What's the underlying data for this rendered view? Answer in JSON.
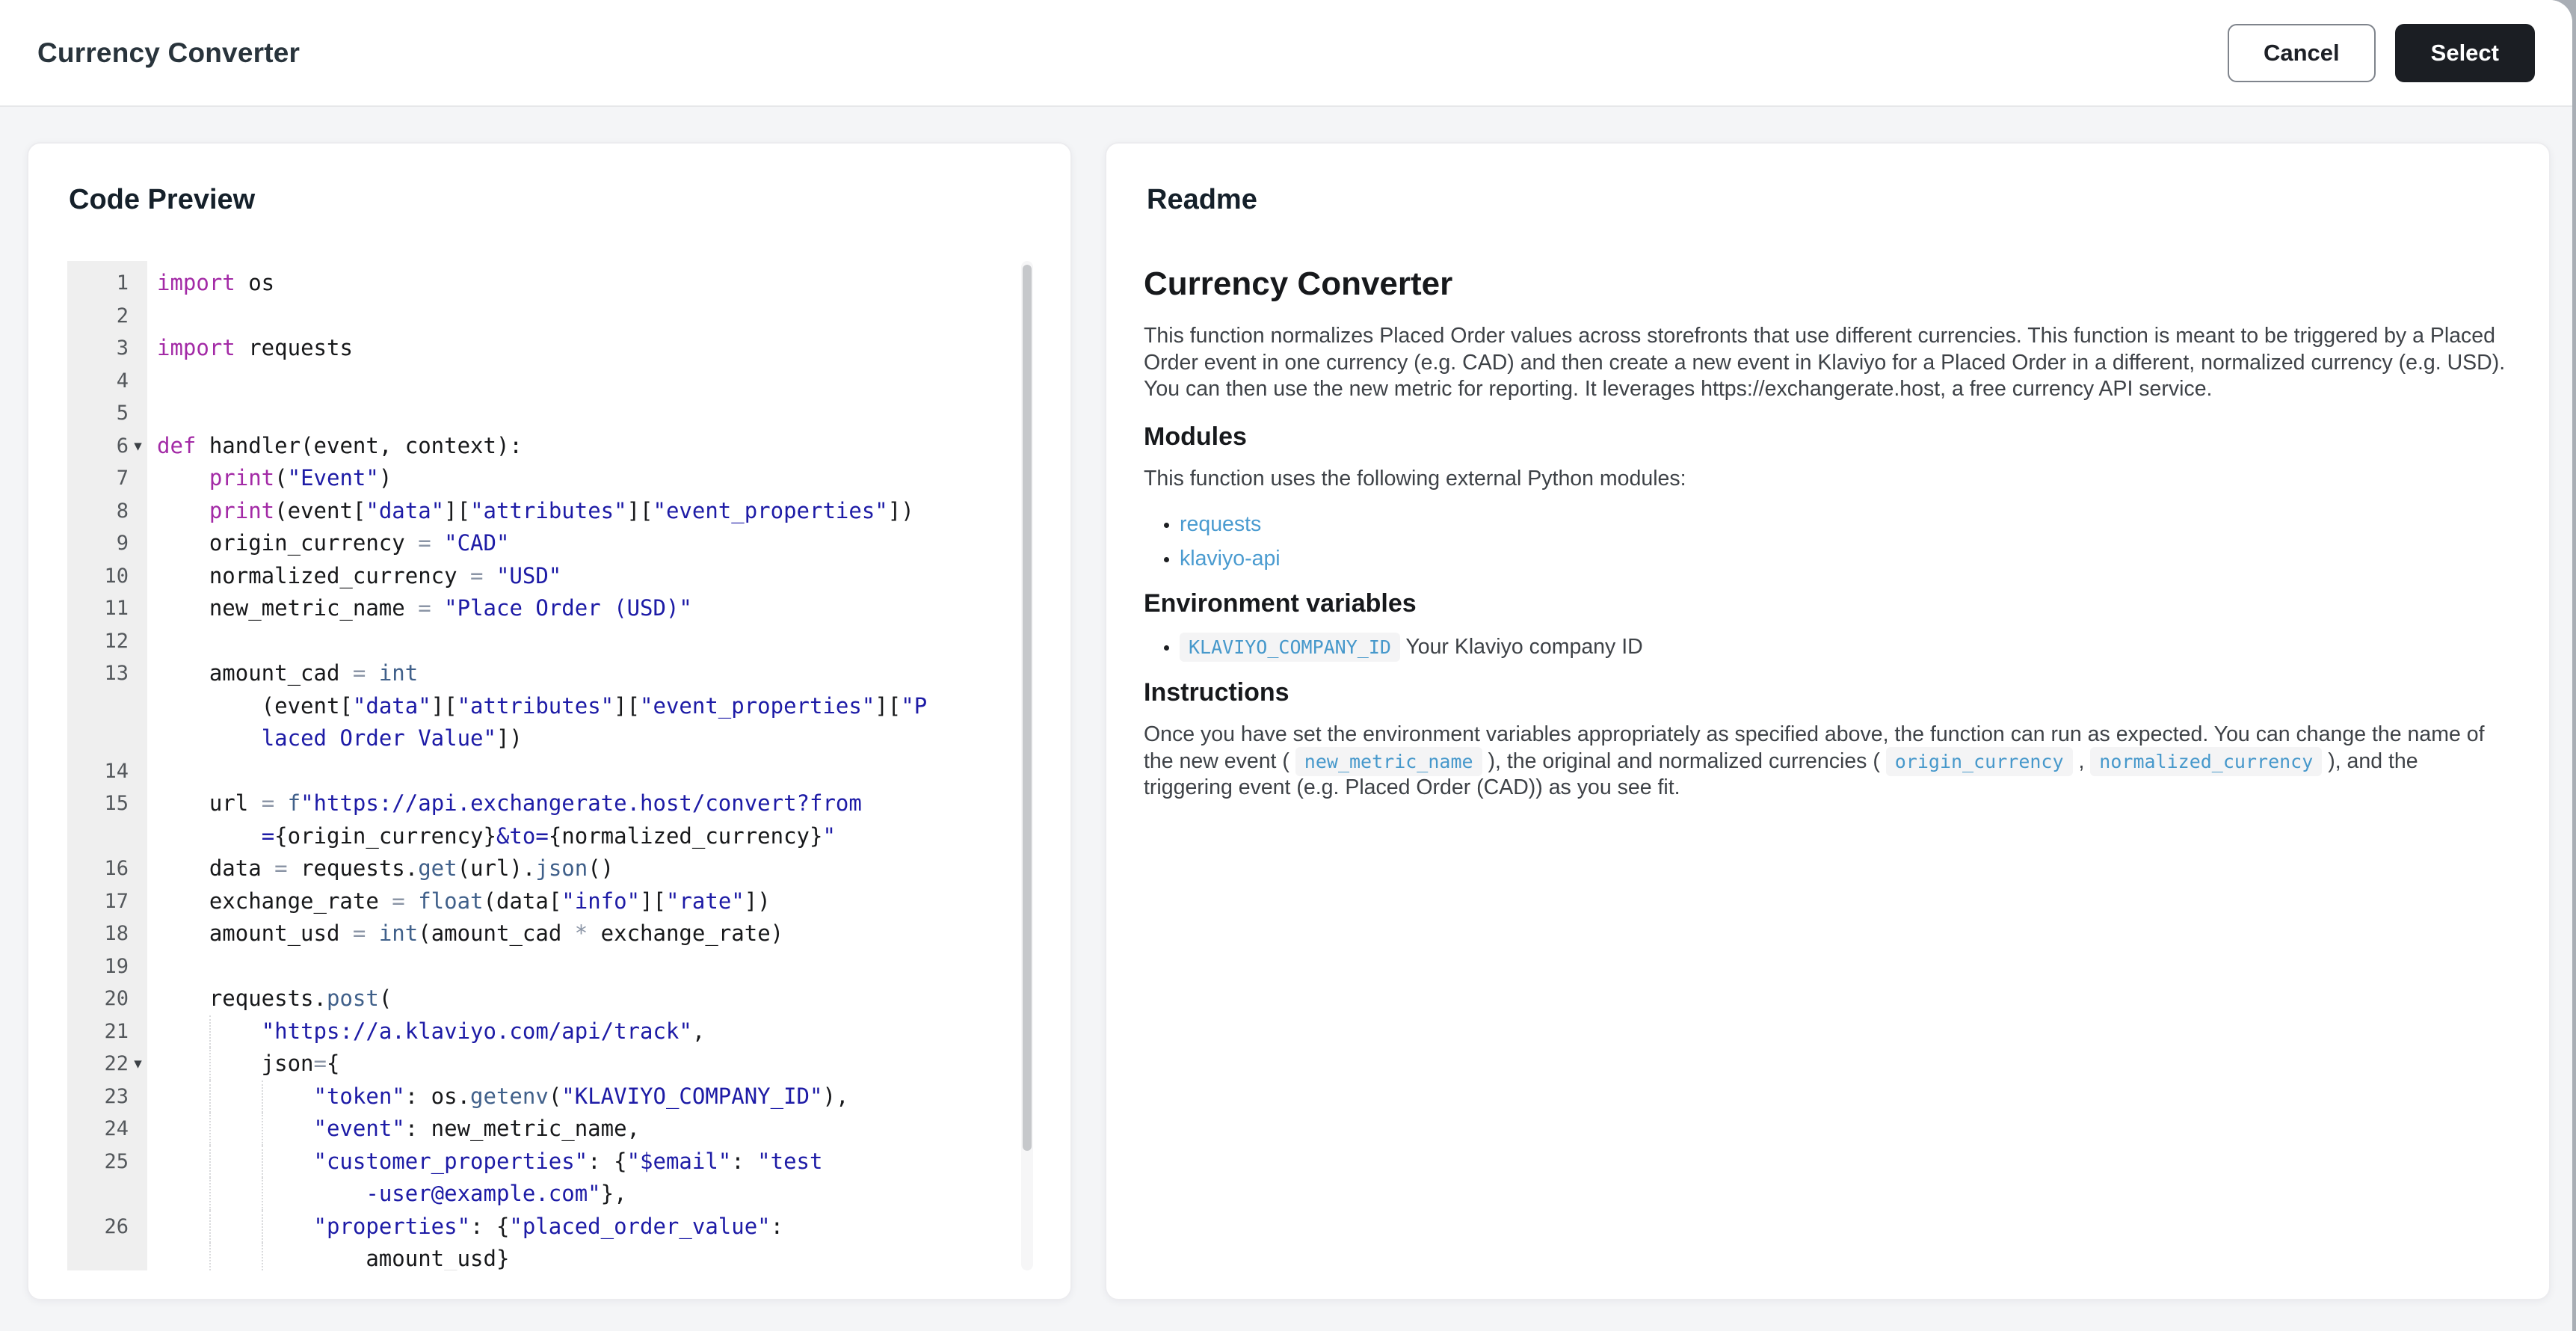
{
  "header": {
    "title": "Currency Converter",
    "cancel_label": "Cancel",
    "select_label": "Select"
  },
  "colors": {
    "accent_dark_button": "#1b1e23",
    "link_blue": "#4a9bd0",
    "inline_code_blue": "#4698cb",
    "token_keyword": "#a32aa6",
    "token_string": "#1d1ba6",
    "token_builtin": "#40608a",
    "token_operator": "#8b95a6",
    "gutter_bg": "#efefef",
    "page_bg": "#f4f5f7"
  },
  "code_panel": {
    "title": "Code Preview",
    "rows": [
      {
        "n": "1",
        "parts": [
          [
            "kw",
            "import"
          ],
          [
            "pl",
            " os"
          ]
        ]
      },
      {
        "n": "2",
        "parts": []
      },
      {
        "n": "3",
        "parts": [
          [
            "kw",
            "import"
          ],
          [
            "pl",
            " requests"
          ]
        ]
      },
      {
        "n": "4",
        "parts": []
      },
      {
        "n": "5",
        "parts": []
      },
      {
        "n": "6",
        "fold": true,
        "parts": [
          [
            "kw",
            "def"
          ],
          [
            "pl",
            " handler(event, context):"
          ]
        ]
      },
      {
        "n": "7",
        "parts": [
          [
            "pl",
            "    "
          ],
          [
            "kw",
            "print"
          ],
          [
            "pl",
            "("
          ],
          [
            "str",
            "\"Event\""
          ],
          [
            "pl",
            ")"
          ]
        ]
      },
      {
        "n": "8",
        "parts": [
          [
            "pl",
            "    "
          ],
          [
            "kw",
            "print"
          ],
          [
            "pl",
            "(event["
          ],
          [
            "str",
            "\"data\""
          ],
          [
            "pl",
            "]["
          ],
          [
            "str",
            "\"attributes\""
          ],
          [
            "pl",
            "]["
          ],
          [
            "str",
            "\"event_properties\""
          ],
          [
            "pl",
            "])"
          ]
        ]
      },
      {
        "n": "9",
        "parts": [
          [
            "pl",
            "    origin_currency "
          ],
          [
            "op",
            "="
          ],
          [
            "pl",
            " "
          ],
          [
            "str",
            "\"CAD\""
          ]
        ]
      },
      {
        "n": "10",
        "parts": [
          [
            "pl",
            "    normalized_currency "
          ],
          [
            "op",
            "="
          ],
          [
            "pl",
            " "
          ],
          [
            "str",
            "\"USD\""
          ]
        ]
      },
      {
        "n": "11",
        "parts": [
          [
            "pl",
            "    new_metric_name "
          ],
          [
            "op",
            "="
          ],
          [
            "pl",
            " "
          ],
          [
            "str",
            "\"Place Order (USD)\""
          ]
        ]
      },
      {
        "n": "12",
        "parts": []
      },
      {
        "n": "13",
        "parts": [
          [
            "pl",
            "    amount_cad "
          ],
          [
            "op",
            "="
          ],
          [
            "pl",
            " "
          ],
          [
            "bi",
            "int"
          ]
        ]
      },
      {
        "n": "",
        "parts": [
          [
            "pl",
            "        (event["
          ],
          [
            "str",
            "\"data\""
          ],
          [
            "pl",
            "]["
          ],
          [
            "str",
            "\"attributes\""
          ],
          [
            "pl",
            "]["
          ],
          [
            "str",
            "\"event_properties\""
          ],
          [
            "pl",
            "]["
          ],
          [
            "str",
            "\"P"
          ]
        ]
      },
      {
        "n": "",
        "parts": [
          [
            "pl",
            "        "
          ],
          [
            "str",
            "laced Order Value\""
          ],
          [
            "pl",
            "])"
          ]
        ]
      },
      {
        "n": "14",
        "parts": []
      },
      {
        "n": "15",
        "parts": [
          [
            "pl",
            "    url "
          ],
          [
            "op",
            "="
          ],
          [
            "pl",
            " "
          ],
          [
            "bi",
            "f"
          ],
          [
            "str",
            "\"https://api.exchangerate.host/convert?from"
          ]
        ]
      },
      {
        "n": "",
        "parts": [
          [
            "pl",
            "        "
          ],
          [
            "str",
            "="
          ],
          [
            "pl",
            "{origin_currency}"
          ],
          [
            "str",
            "&to="
          ],
          [
            "pl",
            "{normalized_currency}"
          ],
          [
            "str",
            "\""
          ]
        ]
      },
      {
        "n": "16",
        "parts": [
          [
            "pl",
            "    data "
          ],
          [
            "op",
            "="
          ],
          [
            "pl",
            " requests."
          ],
          [
            "bi",
            "get"
          ],
          [
            "pl",
            "(url)."
          ],
          [
            "bi",
            "json"
          ],
          [
            "pl",
            "()"
          ]
        ]
      },
      {
        "n": "17",
        "parts": [
          [
            "pl",
            "    exchange_rate "
          ],
          [
            "op",
            "="
          ],
          [
            "pl",
            " "
          ],
          [
            "bi",
            "float"
          ],
          [
            "pl",
            "(data["
          ],
          [
            "str",
            "\"info\""
          ],
          [
            "pl",
            "]["
          ],
          [
            "str",
            "\"rate\""
          ],
          [
            "pl",
            "])"
          ]
        ]
      },
      {
        "n": "18",
        "parts": [
          [
            "pl",
            "    amount_usd "
          ],
          [
            "op",
            "="
          ],
          [
            "pl",
            " "
          ],
          [
            "bi",
            "int"
          ],
          [
            "pl",
            "(amount_cad "
          ],
          [
            "op",
            "*"
          ],
          [
            "pl",
            " exchange_rate)"
          ]
        ]
      },
      {
        "n": "19",
        "parts": []
      },
      {
        "n": "20",
        "parts": [
          [
            "pl",
            "    requests."
          ],
          [
            "bi",
            "post"
          ],
          [
            "pl",
            "("
          ]
        ]
      },
      {
        "n": "21",
        "g": 1,
        "parts": [
          [
            "pl",
            "        "
          ],
          [
            "str",
            "\"https://a.klaviyo.com/api/track\""
          ],
          [
            "pl",
            ","
          ]
        ]
      },
      {
        "n": "22",
        "fold": true,
        "g": 1,
        "parts": [
          [
            "pl",
            "        json"
          ],
          [
            "op",
            "="
          ],
          [
            "pl",
            "{"
          ]
        ]
      },
      {
        "n": "23",
        "g": 2,
        "parts": [
          [
            "pl",
            "            "
          ],
          [
            "str",
            "\"token\""
          ],
          [
            "pl",
            ": os."
          ],
          [
            "bi",
            "getenv"
          ],
          [
            "pl",
            "("
          ],
          [
            "str",
            "\"KLAVIYO_COMPANY_ID\""
          ],
          [
            "pl",
            "),"
          ]
        ]
      },
      {
        "n": "24",
        "g": 2,
        "parts": [
          [
            "pl",
            "            "
          ],
          [
            "str",
            "\"event\""
          ],
          [
            "pl",
            ": new_metric_name,"
          ]
        ]
      },
      {
        "n": "25",
        "g": 2,
        "parts": [
          [
            "pl",
            "            "
          ],
          [
            "str",
            "\"customer_properties\""
          ],
          [
            "pl",
            ": {"
          ],
          [
            "str",
            "\"$email\""
          ],
          [
            "pl",
            ": "
          ],
          [
            "str",
            "\"test"
          ]
        ]
      },
      {
        "n": "",
        "g": 2,
        "parts": [
          [
            "pl",
            "                "
          ],
          [
            "str",
            "-user@example.com\""
          ],
          [
            "pl",
            "},"
          ]
        ]
      },
      {
        "n": "26",
        "g": 2,
        "parts": [
          [
            "pl",
            "            "
          ],
          [
            "str",
            "\"properties\""
          ],
          [
            "pl",
            ": {"
          ],
          [
            "str",
            "\"placed_order_value\""
          ],
          [
            "pl",
            ":"
          ]
        ]
      },
      {
        "n": "",
        "g": 2,
        "parts": [
          [
            "pl",
            "                amount_usd}"
          ]
        ]
      }
    ]
  },
  "readme": {
    "title": "Readme",
    "blocks": [
      {
        "type": "h1",
        "text": "Currency Converter"
      },
      {
        "type": "p",
        "runs": [
          {
            "t": "This function normalizes Placed Order values across storefronts that use different currencies. This function is meant to be triggered by a Placed Order event in one currency (e.g. CAD) and then create a new event in Klaviyo for a Placed Order in a different, normalized currency (e.g. USD). You can then use the new metric for reporting. It leverages https://exchangerate.host, a free currency API service."
          }
        ]
      },
      {
        "type": "h2",
        "text": "Modules"
      },
      {
        "type": "p",
        "runs": [
          {
            "t": "This function uses the following external Python modules:"
          }
        ]
      },
      {
        "type": "ul",
        "items": [
          {
            "runs": [
              {
                "t": "requests",
                "s": "link"
              }
            ]
          },
          {
            "runs": [
              {
                "t": "klaviyo-api",
                "s": "link"
              }
            ]
          }
        ]
      },
      {
        "type": "h2",
        "text": "Environment variables"
      },
      {
        "type": "ul",
        "items": [
          {
            "runs": [
              {
                "t": "KLAVIYO_COMPANY_ID",
                "s": "chip"
              },
              {
                "t": "  Your Klaviyo company ID"
              }
            ]
          }
        ]
      },
      {
        "type": "h2",
        "text": "Instructions"
      },
      {
        "type": "p",
        "runs": [
          {
            "t": "Once you have set the environment variables appropriately as specified above, the function can run as expected. You can change the name of the new event ( "
          },
          {
            "t": "new_metric_name",
            "s": "chip"
          },
          {
            "t": " ), the original and normalized currencies ( "
          },
          {
            "t": "origin_currency",
            "s": "chip"
          },
          {
            "t": " , "
          },
          {
            "t": "normalized_currency",
            "s": "chip"
          },
          {
            "t": " ), and the triggering event (e.g. Placed Order (CAD)) as you see fit."
          }
        ]
      }
    ]
  }
}
